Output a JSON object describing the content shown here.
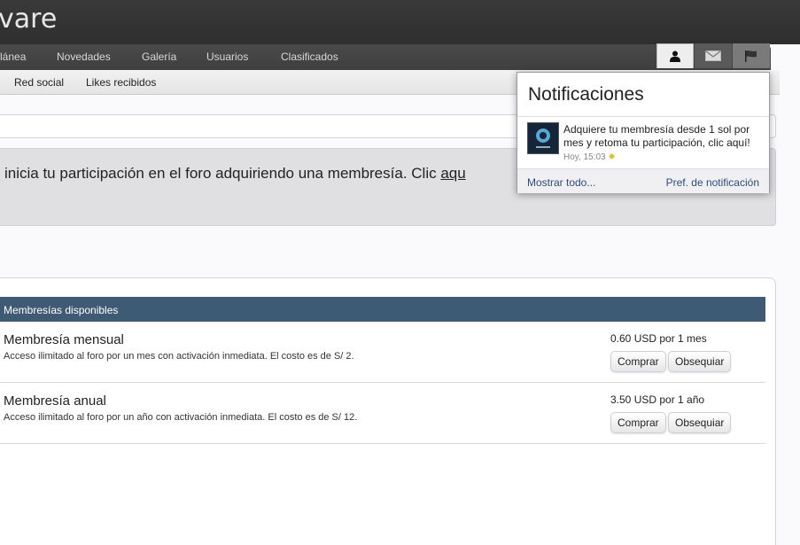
{
  "header": {
    "logo_text": "vare"
  },
  "nav": {
    "tabs": [
      "lánea",
      "Novedades",
      "Galería",
      "Usuarios",
      "Clasificados"
    ],
    "icons": [
      "user-icon",
      "mail-icon",
      "flag-icon"
    ]
  },
  "subnav": {
    "links": [
      "Red social",
      "Likes recibidos"
    ]
  },
  "notice": {
    "text": "inicia tu participación en el foro adquiriendo una membresía. Clic ",
    "link": "aqu"
  },
  "memberships": {
    "heading": "Membresías disponibles",
    "items": [
      {
        "name": "Membresía mensual",
        "description": "Acceso ilimitado al foro por un mes con activación inmediata. El costo es de S/ 2.",
        "price": "0.60 USD por 1 mes",
        "buy_label": "Comprar",
        "gift_label": "Obsequiar"
      },
      {
        "name": "Membresía anual",
        "description": "Acceso ilimitado al foro por un año con activación inmediata. El costo es de S/ 12.",
        "price": "3.50 USD por 1 año",
        "buy_label": "Comprar",
        "gift_label": "Obsequiar"
      }
    ]
  },
  "notifications": {
    "title": "Notificaciones",
    "items": [
      {
        "text": "Adquiere tu membresía desde 1 sol por mes y retoma tu participación, clic aquí!",
        "time": "Hoy, 15:03"
      }
    ],
    "show_all": "Mostrar todo...",
    "prefs": "Pref. de notificación"
  },
  "colors": {
    "header_bg": "#333333",
    "nav_bg": "#444444",
    "table_header_bg": "#3e5a74",
    "link": "#2d4c7a"
  }
}
